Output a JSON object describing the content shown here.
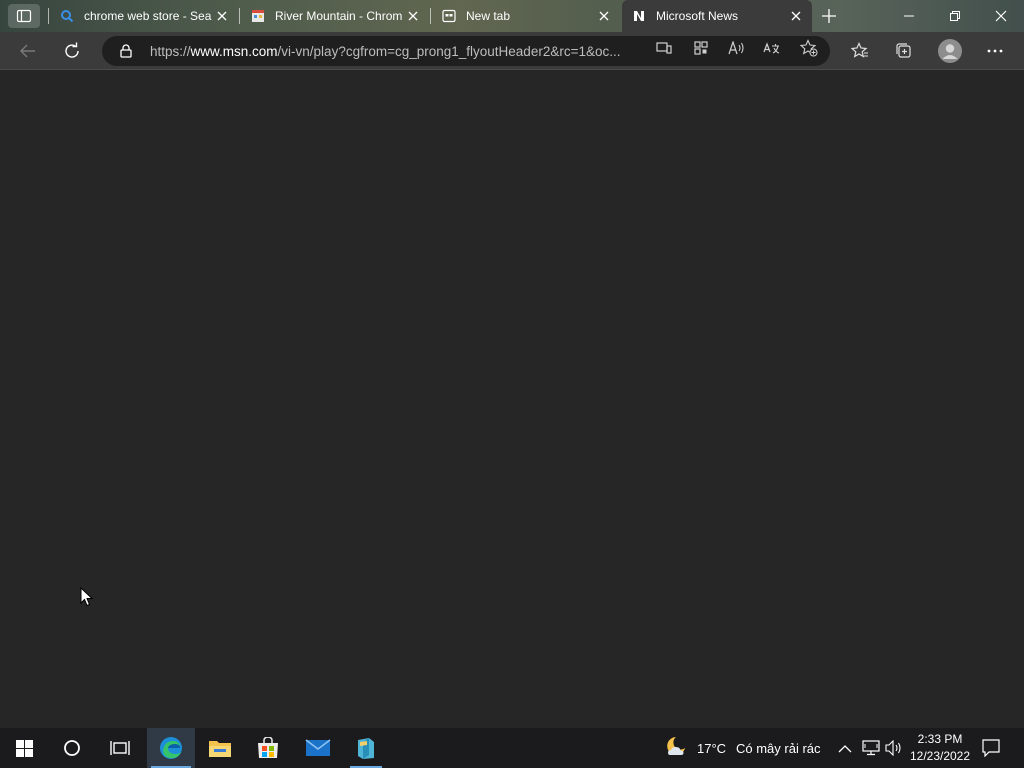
{
  "browser": {
    "tabs": [
      {
        "label": "chrome web store - Sea",
        "icon": "search-icon",
        "active": false
      },
      {
        "label": "River Mountain - Chrom",
        "icon": "store-icon",
        "active": false
      },
      {
        "label": "New tab",
        "icon": "newtab-icon",
        "active": false
      },
      {
        "label": "Microsoft News",
        "icon": "msn-news-icon",
        "active": true
      }
    ],
    "address": {
      "prefix": "https://",
      "host": "www.msn.com",
      "path": "/vi-vn/play?cgfrom=cg_prong1_flyoutHeader2&rc=1&oc..."
    }
  },
  "taskbar": {
    "weather": {
      "temp": "17°C",
      "condition": "Có mây rải rác"
    },
    "clock": {
      "time": "2:33 PM",
      "date": "12/23/2022"
    }
  },
  "colors": {
    "accent": "#6aa8e0",
    "page_bg": "#262626",
    "toolbar_bg": "#3b3b3b"
  }
}
